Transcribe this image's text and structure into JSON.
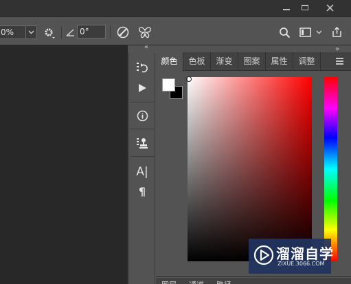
{
  "window": {
    "controls": [
      "minimize",
      "maximize",
      "close"
    ]
  },
  "options_bar": {
    "zoom_value": "0%",
    "angle_value": "0°",
    "icons": [
      "chevron-down-icon",
      "gear-icon",
      "angle-icon",
      "pressure-icon",
      "butterfly-symmetry-icon",
      "search-icon",
      "workspace-icon",
      "chevron-down-icon",
      "share-icon"
    ]
  },
  "collapse": {
    "left": "«",
    "right": "»"
  },
  "tool_strip": {
    "tools": [
      "history-icon",
      "play-action-icon",
      "info-icon",
      "clone-source-icon",
      "character-icon",
      "paragraph-icon"
    ],
    "glyphs": {
      "info": "i",
      "character": "A|",
      "paragraph": "¶"
    }
  },
  "panel": {
    "tabs": [
      {
        "label": "颜色",
        "active": true
      },
      {
        "label": "色板",
        "active": false
      },
      {
        "label": "渐变",
        "active": false
      },
      {
        "label": "图案",
        "active": false
      },
      {
        "label": "属性",
        "active": false
      },
      {
        "label": "调整",
        "active": false
      }
    ],
    "foreground_color": "#ffffff",
    "background_color": "#000000",
    "base_hue": "#ff0000",
    "bottom_tabs": [
      "图层",
      "通道",
      "路径"
    ]
  },
  "watermark": {
    "title": "溜溜自学",
    "subtitle": "ZIXUE.3066.COM"
  }
}
